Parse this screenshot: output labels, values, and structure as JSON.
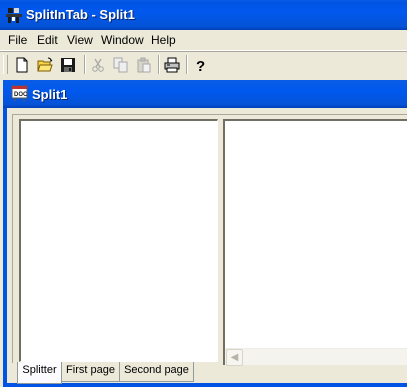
{
  "window": {
    "title": "SplitInTab - Split1"
  },
  "menu": [
    "File",
    "Edit",
    "View",
    "Window",
    "Help"
  ],
  "toolbar": {
    "buttons": [
      {
        "icon": "new-icon",
        "enabled": true
      },
      {
        "icon": "open-icon",
        "enabled": true
      },
      {
        "icon": "save-icon",
        "enabled": true
      },
      {
        "icon": "cut-icon",
        "enabled": false
      },
      {
        "icon": "copy-icon",
        "enabled": false
      },
      {
        "icon": "paste-icon",
        "enabled": false
      },
      {
        "icon": "print-icon",
        "enabled": true
      },
      {
        "icon": "help-icon",
        "enabled": true
      }
    ]
  },
  "child": {
    "title": "Split1"
  },
  "tabs": [
    {
      "label": "Splitter",
      "active": true
    },
    {
      "label": "First page",
      "active": false
    },
    {
      "label": "Second page",
      "active": false
    }
  ],
  "colors": {
    "titlebar": "#0054e3",
    "face": "#ece9d8"
  }
}
